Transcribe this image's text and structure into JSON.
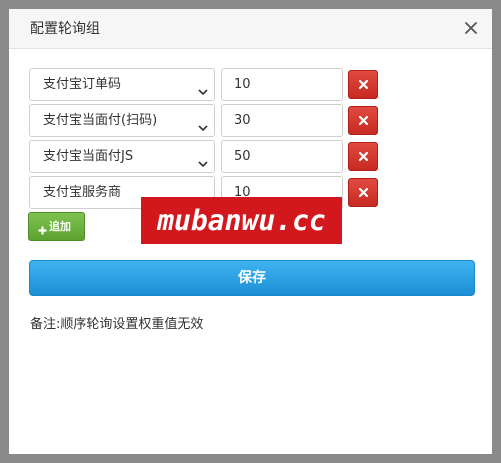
{
  "dialog": {
    "title": "配置轮询组",
    "rows": [
      {
        "channel": "支付宝订单码",
        "weight": "10"
      },
      {
        "channel": "支付宝当面付(扫码)",
        "weight": "30"
      },
      {
        "channel": "支付宝当面付JS",
        "weight": "50"
      },
      {
        "channel": "支付宝服务商",
        "weight": "10"
      }
    ],
    "add_label": "追加",
    "save_label": "保存",
    "note": "备注:顺序轮询设置权重值无效"
  },
  "watermark": "mubanwu.cc",
  "colors": {
    "delete": "#d33a32",
    "add": "#6fb241",
    "save": "#2b9fe3",
    "watermark": "#d2171d"
  },
  "icons": {
    "close": "close-icon",
    "delete": "x-icon",
    "add": "plus-icon",
    "select": "chevron-down-icon"
  }
}
